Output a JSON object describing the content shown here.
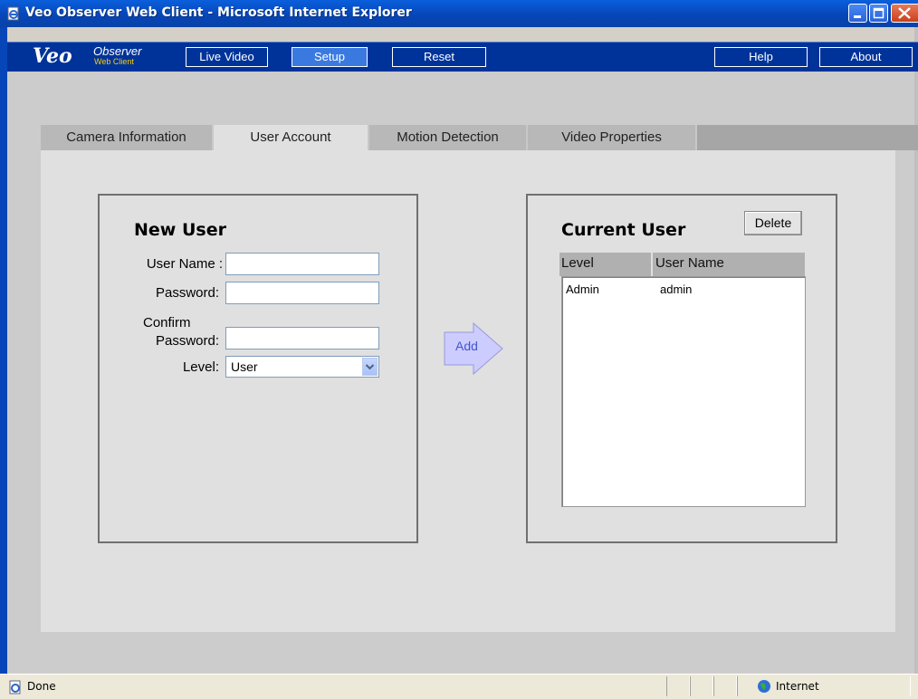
{
  "window": {
    "title": "Veo Observer Web Client - Microsoft Internet Explorer"
  },
  "app": {
    "logo_main": "Veo",
    "logo_observer": "Observer",
    "logo_webclient": "Web Client",
    "nav": {
      "live_video": "Live Video",
      "setup": "Setup",
      "reset": "Reset",
      "help": "Help",
      "about": "About"
    },
    "active_nav": "Setup"
  },
  "tabs": {
    "camera_info": "Camera Information",
    "user_account": "User Account",
    "motion_detection": "Motion Detection",
    "video_properties": "Video Properties",
    "active": "User Account"
  },
  "new_user": {
    "title": "New User",
    "username_label": "User Name :",
    "password_label": "Password:",
    "confirm_label_line1": "Confirm",
    "confirm_label_line2": "Password:",
    "level_label": "Level:",
    "username_value": "",
    "password_value": "",
    "confirm_value": "",
    "level_value": "User"
  },
  "add_button": "Add",
  "current_user": {
    "title": "Current User",
    "delete_label": "Delete",
    "columns": [
      "Level",
      "User Name"
    ],
    "rows": [
      {
        "level": "Admin",
        "username": "admin"
      }
    ]
  },
  "statusbar": {
    "status": "Done",
    "zone": "Internet"
  },
  "colors": {
    "title_bar": "#0646b8",
    "app_bar": "#003399",
    "active_nav": "#3a7ae0",
    "logo_accent": "#ffcc00"
  }
}
